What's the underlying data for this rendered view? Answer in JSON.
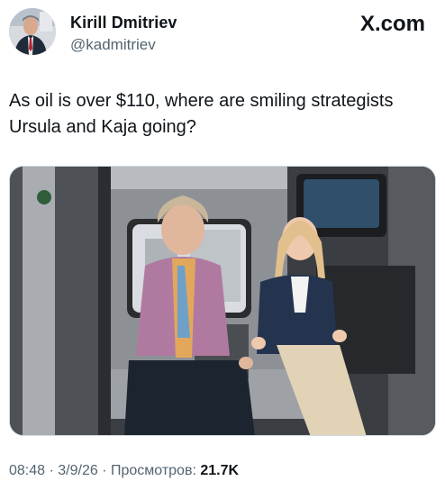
{
  "author": {
    "display_name": "Kirill Dmitriev",
    "handle": "@kadmitriev"
  },
  "site_label": "X.com",
  "tweet": {
    "text_line1": "As oil is over $110, where are smiling strategists",
    "text_line2": "Ursula and Kaja going?"
  },
  "meta": {
    "time": "08:48",
    "sep1": " · ",
    "date": "3/9/26",
    "sep2": " · ",
    "views_label": "Просмотров: ",
    "views_count": "21.7K"
  },
  "icons": {
    "avatar": "profile-photo",
    "media": "photo-two-women-seated-in-vehicle"
  },
  "colors": {
    "text": "#0f1419",
    "secondary": "#536471",
    "border": "#cfd9de"
  }
}
